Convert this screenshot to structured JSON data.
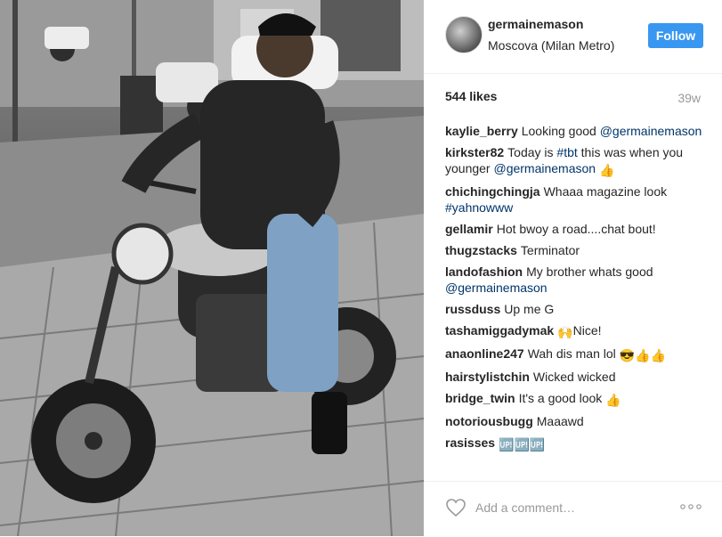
{
  "post": {
    "username": "germainemason",
    "location": "Moscova (Milan Metro)",
    "follow_label": "Follow",
    "likes": "544 likes",
    "time_ago": "39w",
    "comment_placeholder": "Add a comment…",
    "accent_color": "#3897f0"
  },
  "comments": [
    {
      "user": "kaylie_berry",
      "text": "Looking good ",
      "mention": "@germainemason",
      "tag": "",
      "emoji": ""
    },
    {
      "user": "kirkster82",
      "text": "Today is ",
      "tag": "#tbt",
      "text2": " this was when you younger ",
      "mention": "@germainemason",
      "emoji": "👍"
    },
    {
      "user": "chichingchingja",
      "text": "Whaaa magazine look ",
      "tag": "#yahnowww",
      "mention": "",
      "emoji": ""
    },
    {
      "user": "gellamir",
      "text": "Hot bwoy a road....chat bout!",
      "mention": "",
      "tag": "",
      "emoji": ""
    },
    {
      "user": "thugzstacks",
      "text": "Terminator",
      "mention": "",
      "tag": "",
      "emoji": ""
    },
    {
      "user": "landofashion",
      "text": "My brother whats good ",
      "mention": "@germainemason",
      "tag": "",
      "emoji": ""
    },
    {
      "user": "russduss",
      "text": "Up me G",
      "mention": "",
      "tag": "",
      "emoji": ""
    },
    {
      "user": "tashamiggadymak",
      "text": "Nice!",
      "mention": "",
      "tag": "",
      "emoji": "🙌"
    },
    {
      "user": "anaonline247",
      "text": "Wah dis man lol ",
      "mention": "",
      "tag": "",
      "emoji": "😎👍👍"
    },
    {
      "user": "hairstylistchin",
      "text": "Wicked wicked",
      "mention": "",
      "tag": "",
      "emoji": ""
    },
    {
      "user": "bridge_twin",
      "text": "It's a good look ",
      "mention": "",
      "tag": "",
      "emoji": "👍"
    },
    {
      "user": "notoriousbugg",
      "text": "Maaawd",
      "mention": "",
      "tag": "",
      "emoji": ""
    },
    {
      "user": "rasisses",
      "text": "",
      "mention": "",
      "tag": "",
      "emoji": "🆙🆙🆙"
    }
  ]
}
